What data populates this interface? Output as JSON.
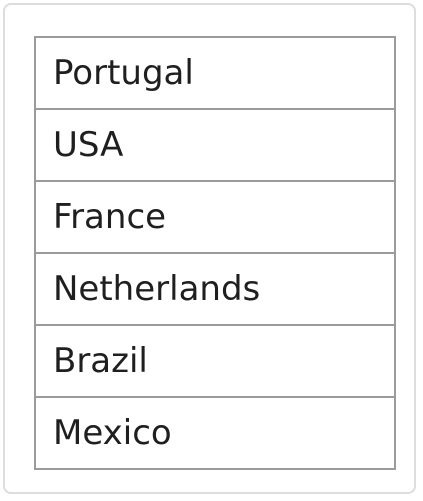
{
  "list": {
    "items": [
      {
        "label": "Portugal"
      },
      {
        "label": "USA"
      },
      {
        "label": "France"
      },
      {
        "label": "Netherlands"
      },
      {
        "label": "Brazil"
      },
      {
        "label": "Mexico"
      }
    ]
  }
}
